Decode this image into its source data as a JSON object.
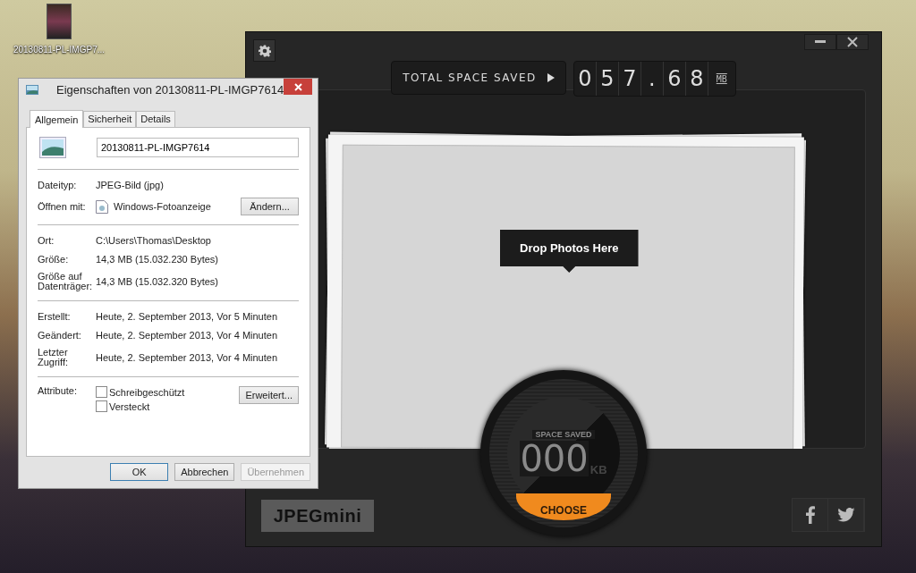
{
  "desktop_icon": {
    "label": "20130811-PL-IMGP7..."
  },
  "jpegmini": {
    "counter_label": "TOTAL SPACE SAVED",
    "counter_digits": [
      "0",
      "5",
      "7",
      ".",
      "6",
      "8"
    ],
    "counter_unit": "MB",
    "drop_hint": "Drop Photos Here",
    "gauge": {
      "label": "SPACE SAVED",
      "digits": "000",
      "unit": "KB",
      "button": "CHOOSE"
    },
    "logo": "JPEGmini"
  },
  "dialog": {
    "title": "Eigenschaften von 20130811-PL-IMGP7614",
    "tabs": [
      {
        "label": "Allgemein",
        "selected": true
      },
      {
        "label": "Sicherheit",
        "selected": false
      },
      {
        "label": "Details",
        "selected": false
      }
    ],
    "file_name": "20130811-PL-IMGP7614",
    "groups": [
      {
        "rows": [
          {
            "kind": "text",
            "label": "Dateityp:",
            "value": "JPEG-Bild (jpg)"
          },
          {
            "kind": "app",
            "label": "Öffnen mit:",
            "value": "Windows-Fotoanzeige",
            "button": "Ändern..."
          }
        ]
      },
      {
        "rows": [
          {
            "kind": "text",
            "label": "Ort:",
            "value": "C:\\Users\\Thomas\\Desktop"
          },
          {
            "kind": "text",
            "label": "Größe:",
            "value": "14,3 MB (15.032.230 Bytes)"
          },
          {
            "kind": "text",
            "label": "Größe auf Datenträger:",
            "value": "14,3 MB (15.032.320 Bytes)"
          }
        ]
      },
      {
        "rows": [
          {
            "kind": "text",
            "label": "Erstellt:",
            "value": "Heute, 2. September 2013, Vor 5 Minuten"
          },
          {
            "kind": "text",
            "label": "Geändert:",
            "value": "Heute, 2. September 2013, Vor 4 Minuten"
          },
          {
            "kind": "text",
            "label": "Letzter Zugriff:",
            "value": "Heute, 2. September 2013, Vor 4 Minuten"
          }
        ]
      },
      {
        "rows": [
          {
            "kind": "checkboxes",
            "label": "Attribute:",
            "options": [
              {
                "label": "Schreibgeschützt",
                "checked": false
              },
              {
                "label": "Versteckt",
                "checked": false
              }
            ],
            "button": "Erweitert..."
          }
        ]
      }
    ],
    "buttons": [
      {
        "label": "OK",
        "default": true,
        "disabled": false
      },
      {
        "label": "Abbrechen",
        "default": false,
        "disabled": false
      },
      {
        "label": "Übernehmen",
        "default": false,
        "disabled": true
      }
    ]
  }
}
